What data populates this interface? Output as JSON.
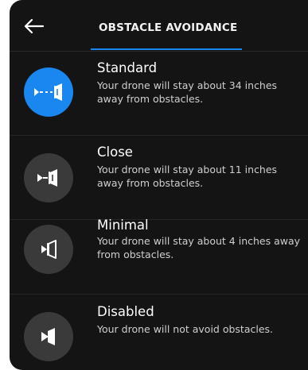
{
  "header": {
    "title": "OBSTACLE AVOIDANCE",
    "back_icon": "back-arrow-icon"
  },
  "accent_color": "#1a86f0",
  "options": [
    {
      "label": "Standard",
      "description": "Your drone will stay about 34 inches away from obstacles.",
      "icon": "standard-distance-icon",
      "selected": true
    },
    {
      "label": "Close",
      "description": "Your drone will stay about 11 inches away from obstacles.",
      "icon": "close-distance-icon",
      "selected": false
    },
    {
      "label": "Minimal",
      "description": "Your drone will stay about 4 inches away from obstacles.",
      "icon": "minimal-distance-icon",
      "selected": false
    },
    {
      "label": "Disabled",
      "description": "Your drone will not avoid obstacles.",
      "icon": "disabled-avoidance-icon",
      "selected": false
    }
  ]
}
